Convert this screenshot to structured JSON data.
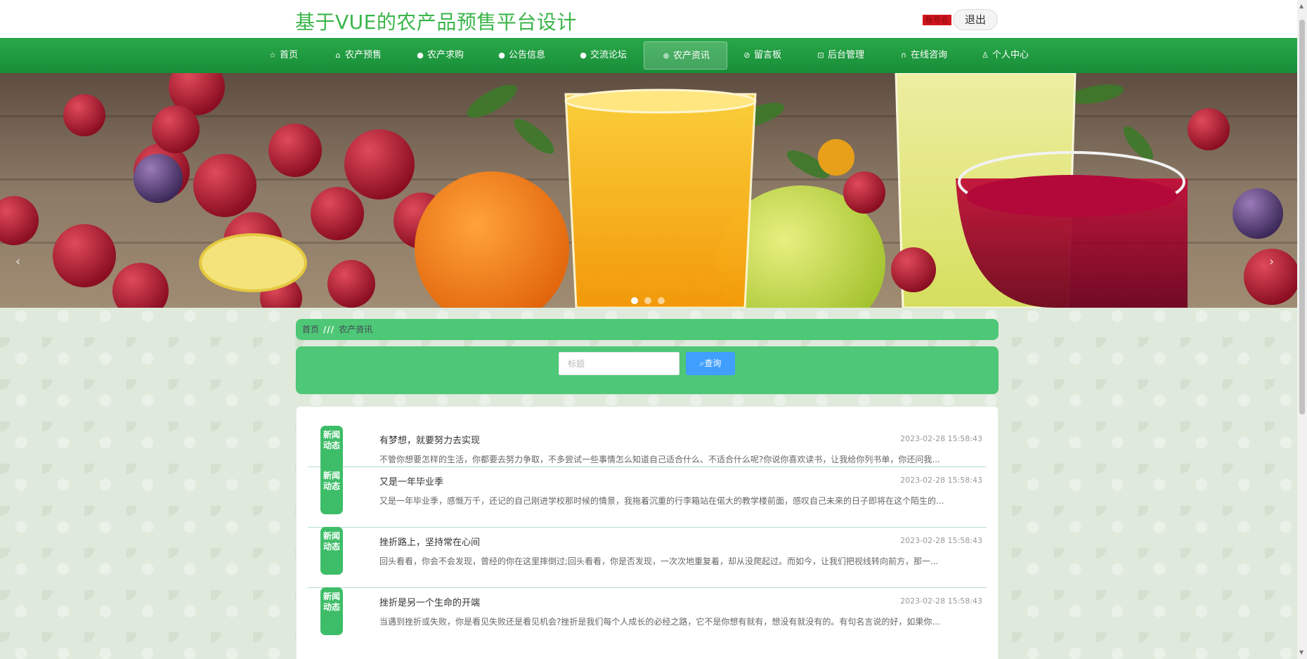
{
  "header": {
    "title": "基于VUE的农产品预售平台设计",
    "user_tag": "账号名",
    "logout_label": "退出"
  },
  "nav": {
    "items": [
      {
        "label": "首页",
        "icon": "star-icon"
      },
      {
        "label": "农产预售",
        "icon": "bag-icon"
      },
      {
        "label": "农产求购",
        "icon": "info-icon"
      },
      {
        "label": "公告信息",
        "icon": "info-icon"
      },
      {
        "label": "交流论坛",
        "icon": "info-icon"
      },
      {
        "label": "农产资讯",
        "icon": "globe-icon"
      },
      {
        "label": "留言板",
        "icon": "compass-icon"
      },
      {
        "label": "后台管理",
        "icon": "gift-icon"
      },
      {
        "label": "在线咨询",
        "icon": "headset-icon"
      },
      {
        "label": "个人中心",
        "icon": "user-icon"
      }
    ],
    "active": "农产资讯"
  },
  "carousel": {
    "slide_count": 3,
    "active_index": 0,
    "prev_glyph": "‹",
    "next_glyph": "›"
  },
  "breadcrumb": {
    "home": "首页",
    "separator": "///",
    "current": "农产资讯"
  },
  "search": {
    "placeholder": "标题",
    "value": "",
    "button_label": "查询"
  },
  "news": {
    "badge_text": "新闻动态",
    "items": [
      {
        "title": "有梦想，就要努力去实现",
        "date": "2023-02-28 15:58:43",
        "summary": "不管你想要怎样的生活，你都要去努力争取，不多尝试一些事情怎么知道自己适合什么、不适合什么呢?你说你喜欢读书，让我给你列书单，你还问我..."
      },
      {
        "title": "又是一年毕业季",
        "date": "2023-02-28 15:58:43",
        "summary": "又是一年毕业季，感慨万千，还记的自己刚进学校那时候的情景，我拖着沉重的行李箱站在偌大的教学楼前面，感叹自己未来的日子即将在这个陌生的..."
      },
      {
        "title": "挫折路上，坚持常在心间",
        "date": "2023-02-28 15:58:43",
        "summary": "回头看看，你会不会发现，曾经的你在这里摔倒过;回头看看，你是否发现，一次次地重复着，却从没爬起过。而如今，让我们把视线转向前方，那一..."
      },
      {
        "title": "挫折是另一个生命的开端",
        "date": "2023-02-28 15:58:43",
        "summary": "当遇到挫折或失败，你是看见失败还是看见机会?挫折是我们每个人成长的必经之路，它不是你想有就有，想没有就没有的。有句名言说的好，如果你..."
      }
    ]
  },
  "colors": {
    "brand_green": "#3bb54a",
    "nav_green": "#178e38",
    "panel_green": "#4ec776",
    "search_button": "#409eff",
    "badge_green": "#3ebd68"
  }
}
